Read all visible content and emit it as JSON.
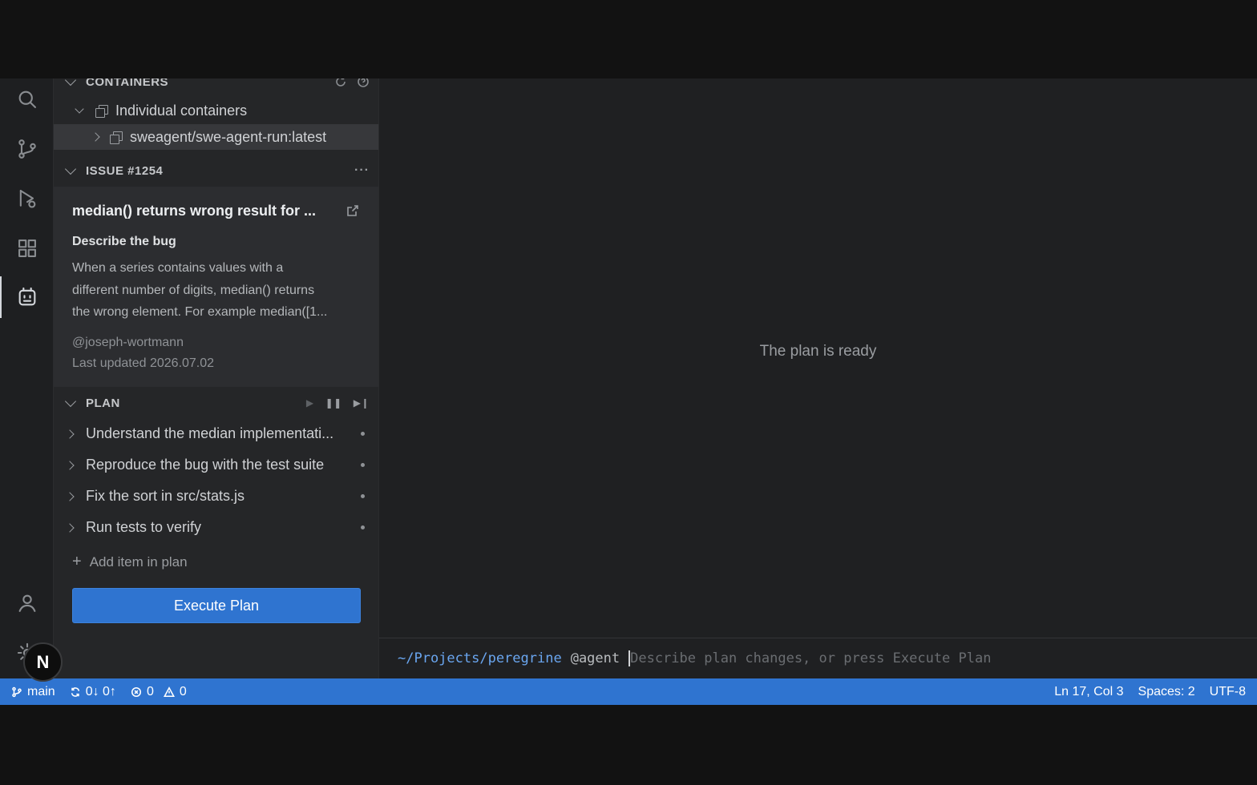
{
  "sidebar": {
    "containers": {
      "header": "CONTAINERS",
      "group_label": "Individual containers",
      "item_label": "sweagent/swe-agent-run:latest"
    },
    "issue": {
      "header": "ISSUE #1254",
      "title": "median() returns wrong result for ...",
      "subtitle": "Describe the bug",
      "body": "When a series contains values with a\ndifferent number of digits, median() returns\nthe wrong element. For example median([1...",
      "author": "@joseph-wortmann",
      "updated": "Last updated 2026.07.02"
    },
    "plan": {
      "header": "PLAN",
      "items": [
        {
          "label": "Understand the median implementati..."
        },
        {
          "label": "Reproduce the bug with the test suite"
        },
        {
          "label": "Fix the sort in src/stats.js"
        },
        {
          "label": "Run tests to verify"
        }
      ],
      "add_label": "Add item in plan",
      "execute_label": "Execute Plan"
    }
  },
  "editor": {
    "message": "The plan is ready"
  },
  "prompt": {
    "cwd": "~/Projects/peregrine",
    "agent": "@agent",
    "placeholder": "Describe plan changes, or press Execute Plan"
  },
  "status_bar": {
    "branch": "main",
    "sync": "0↓ 0↑",
    "errors": "0",
    "warnings": "0",
    "position": "Ln 17, Col 3",
    "spaces": "Spaces: 2",
    "encoding": "UTF-8"
  },
  "badge": {
    "letter": "N"
  },
  "icons": {
    "activity_bar": [
      "search-icon",
      "source-control-icon",
      "run-debug-icon",
      "extensions-icon",
      "agent-icon",
      "account-icon",
      "settings-icon"
    ],
    "accent_color": "#2f74d0"
  }
}
